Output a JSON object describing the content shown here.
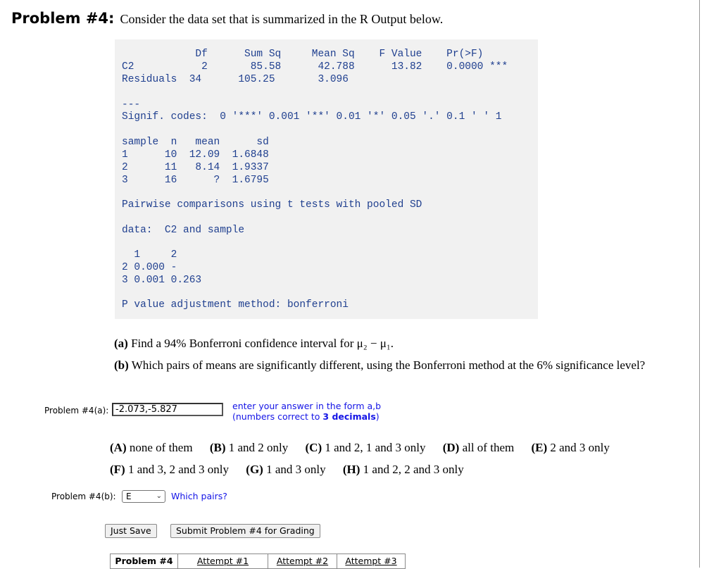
{
  "header": {
    "problem_label": "Problem #4:",
    "intro": "Consider the data set that is summarized in the R Output below."
  },
  "r_output": {
    "anova": {
      "header": "            Df      Sum Sq     Mean Sq    F Value    Pr(>F)",
      "rows": [
        "C2           2       85.58      42.788      13.82    0.0000 ***",
        "Residuals  34      105.25       3.096"
      ],
      "separator": "---",
      "signif_codes": "Signif. codes:  0 '***' 0.001 '**' 0.01 '*' 0.05 '.' 0.1 ' ' 1"
    },
    "summary": {
      "header": "sample  n   mean      sd",
      "rows": [
        "1      10  12.09  1.6848",
        "2      11   8.14  1.9337",
        "3      16      ?  1.6795"
      ]
    },
    "pairwise": {
      "title": "Pairwise comparisons using t tests with pooled SD",
      "data_line": "data:  C2 and sample",
      "matrix_header": "  1     2",
      "matrix_rows": [
        "2 0.000 -",
        "3 0.001 0.263"
      ],
      "adjustment": "P value adjustment method: bonferroni"
    }
  },
  "questions": {
    "a_label": "(a)",
    "a_text": "Find a 94% Bonferroni confidence interval for μ₂ − μ₁.",
    "b_label": "(b)",
    "b_text": "Which pairs of means are significantly different, using the Bonferroni method at the 6% significance level?"
  },
  "answer_a": {
    "label": "Problem #4(a):",
    "value": "-2.073,-5.827",
    "hint_line1": "enter your answer in the form a,b",
    "hint_line2_prefix": "(numbers correct to ",
    "hint_line2_bold": "3 decimals",
    "hint_line2_suffix": ")"
  },
  "options": {
    "row1": [
      {
        "key": "(A)",
        "text": "none of them"
      },
      {
        "key": "(B)",
        "text": "1 and 2 only"
      },
      {
        "key": "(C)",
        "text": "1 and 2, 1 and 3 only"
      },
      {
        "key": "(D)",
        "text": "all of them"
      },
      {
        "key": "(E)",
        "text": "2 and 3 only"
      }
    ],
    "row2": [
      {
        "key": "(F)",
        "text": "1 and 3, 2 and 3 only"
      },
      {
        "key": "(G)",
        "text": "1 and 3 only"
      },
      {
        "key": "(H)",
        "text": "1 and 2, 2 and 3 only"
      }
    ]
  },
  "answer_b": {
    "label": "Problem #4(b):",
    "selected": "E",
    "hint": "Which pairs?"
  },
  "buttons": {
    "save": "Just Save",
    "submit": "Submit Problem #4 for Grading"
  },
  "tabs": [
    {
      "label": "Problem #4",
      "active": true
    },
    {
      "label": "Attempt #1",
      "active": false
    },
    {
      "label": "Attempt #2",
      "active": false
    },
    {
      "label": "Attempt #3",
      "active": false
    }
  ],
  "colors": {
    "r_text": "#1f3f8f",
    "r_background": "#f1f1f1",
    "hint_blue": "#1414e6"
  }
}
